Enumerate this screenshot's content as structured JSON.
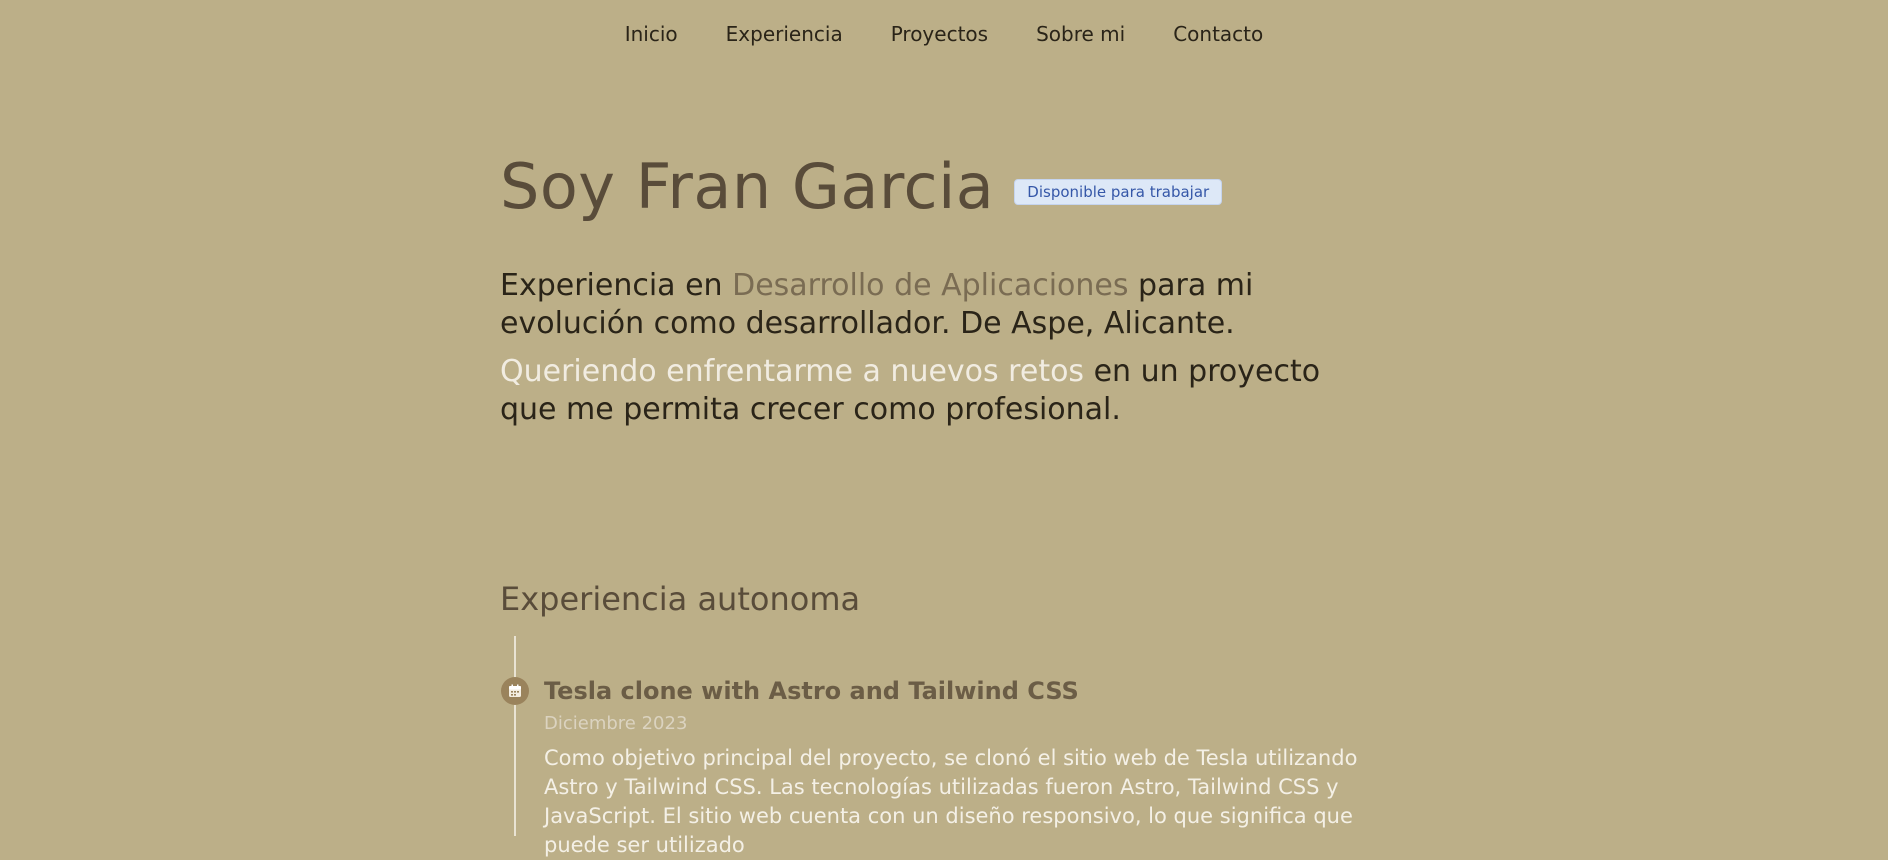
{
  "nav": {
    "items": [
      "Inicio",
      "Experiencia",
      "Proyectos",
      "Sobre mi",
      "Contacto"
    ]
  },
  "hero": {
    "title": "Soy Fran Garcia",
    "badge": "Disponible para trabajar",
    "p1_a": "Experiencia en ",
    "p1_b": "Desarrollo de Aplicaciones",
    "p1_c": " para mi evolución como desarrollador. De Aspe, Alicante.",
    "p2_a": "Queriendo enfrentarme a nuevos retos",
    "p2_b": " en un proyecto que me permita crecer como profesional."
  },
  "experience": {
    "section_title": "Experiencia autonoma",
    "entries": [
      {
        "title": "Tesla clone with Astro and Tailwind CSS",
        "date": "Diciembre 2023",
        "description": "Como objetivo principal del proyecto, se clonó el sitio web de Tesla utilizando Astro y Tailwind CSS. Las tecnologías utilizadas fueron Astro, Tailwind CSS y JavaScript. El sitio web cuenta con un diseño responsivo, lo que significa que puede ser utilizado"
      }
    ]
  },
  "colors": {
    "background": "#bcaf88",
    "title": "#594c3a",
    "accent_brown": "#7a6c53",
    "accent_light": "#f1ece1",
    "badge_bg": "#dde8f7",
    "badge_text": "#3557a8"
  },
  "icons": {
    "timeline": "calendar-icon"
  }
}
